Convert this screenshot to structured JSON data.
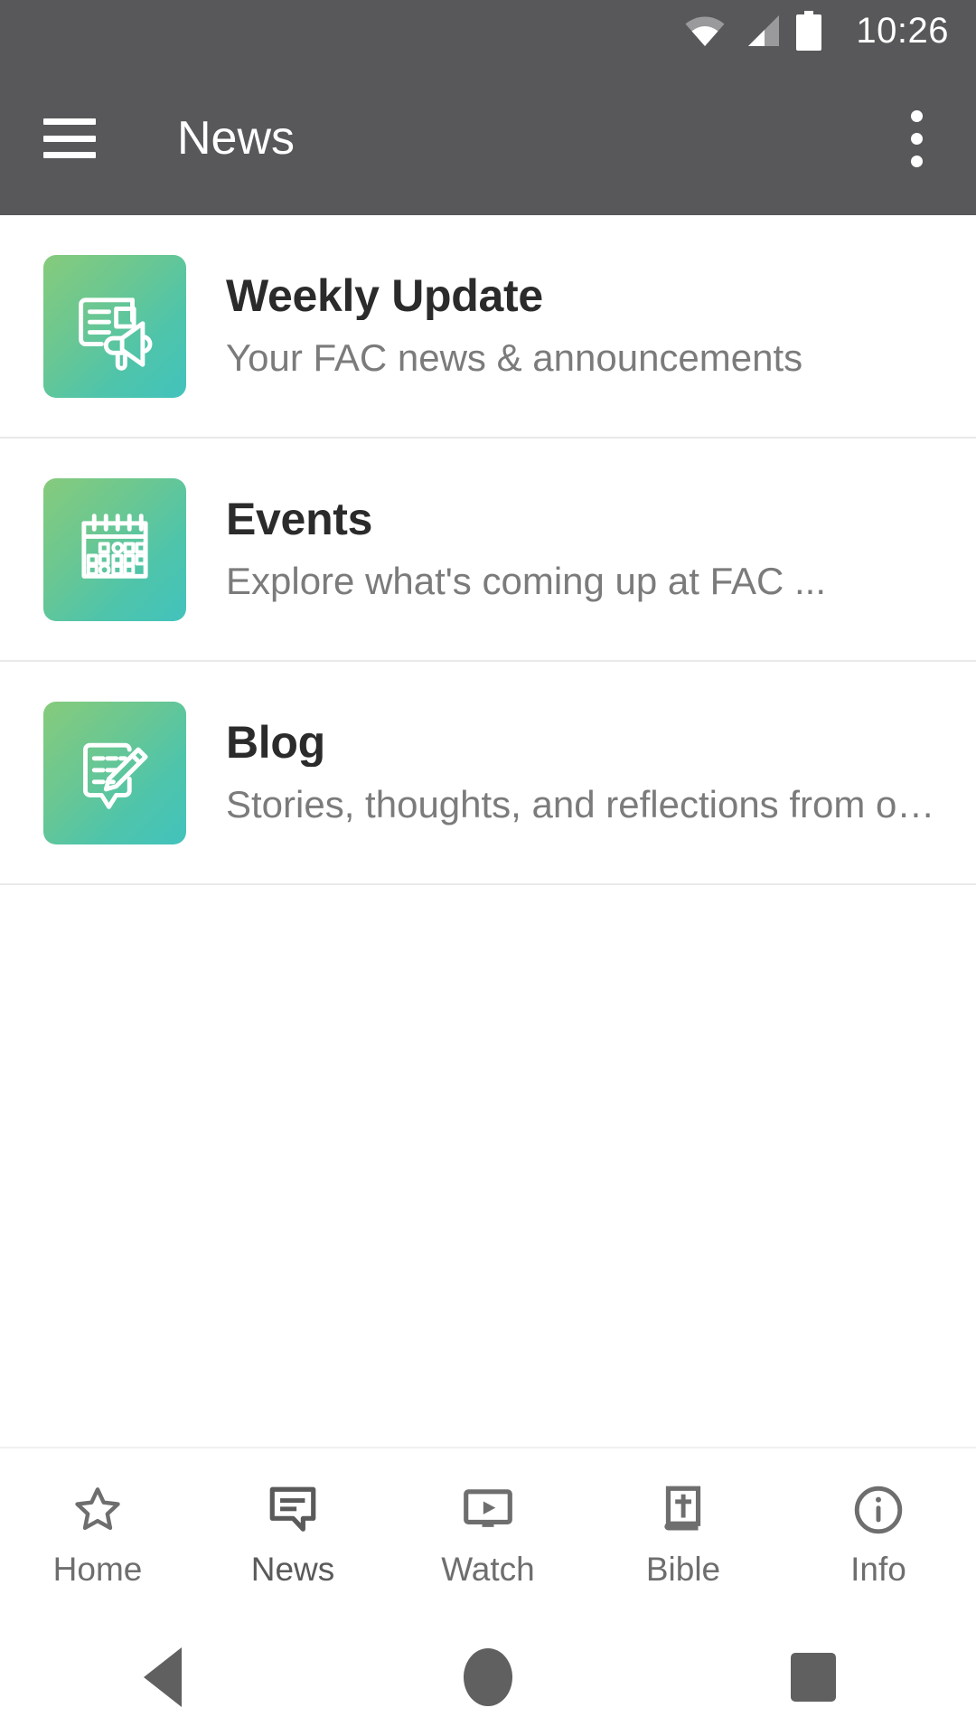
{
  "statusbar": {
    "time": "10:26",
    "wifi_icon": "wifi-icon",
    "signal_icon": "cellular-signal-icon",
    "battery_icon": "battery-full-icon"
  },
  "appbar": {
    "menu_icon": "hamburger-menu-icon",
    "title": "News",
    "overflow_icon": "more-vertical-icon",
    "background": "#58585b"
  },
  "list": {
    "items": [
      {
        "icon": "newspaper-megaphone-icon",
        "title": "Weekly Update",
        "subtitle": "Your FAC news & announcements"
      },
      {
        "icon": "calendar-icon",
        "title": "Events",
        "subtitle": "Explore what's coming up at FAC ..."
      },
      {
        "icon": "note-pencil-icon",
        "title": "Blog",
        "subtitle": "Stories, thoughts, and reflections from o…"
      }
    ],
    "tile_gradient_start": "#86cb7c",
    "tile_gradient_end": "#43c3bd"
  },
  "bottomnav": {
    "items": [
      {
        "label": "Home",
        "icon": "star-outline-icon"
      },
      {
        "label": "News",
        "icon": "chat-bubble-lines-icon"
      },
      {
        "label": "Watch",
        "icon": "monitor-play-icon"
      },
      {
        "label": "Bible",
        "icon": "book-cross-icon"
      },
      {
        "label": "Info",
        "icon": "info-circle-icon"
      }
    ],
    "active": "News"
  },
  "androidnav": {
    "back_icon": "triangle-back-icon",
    "home_icon": "circle-home-icon",
    "recents_icon": "square-recents-icon"
  }
}
